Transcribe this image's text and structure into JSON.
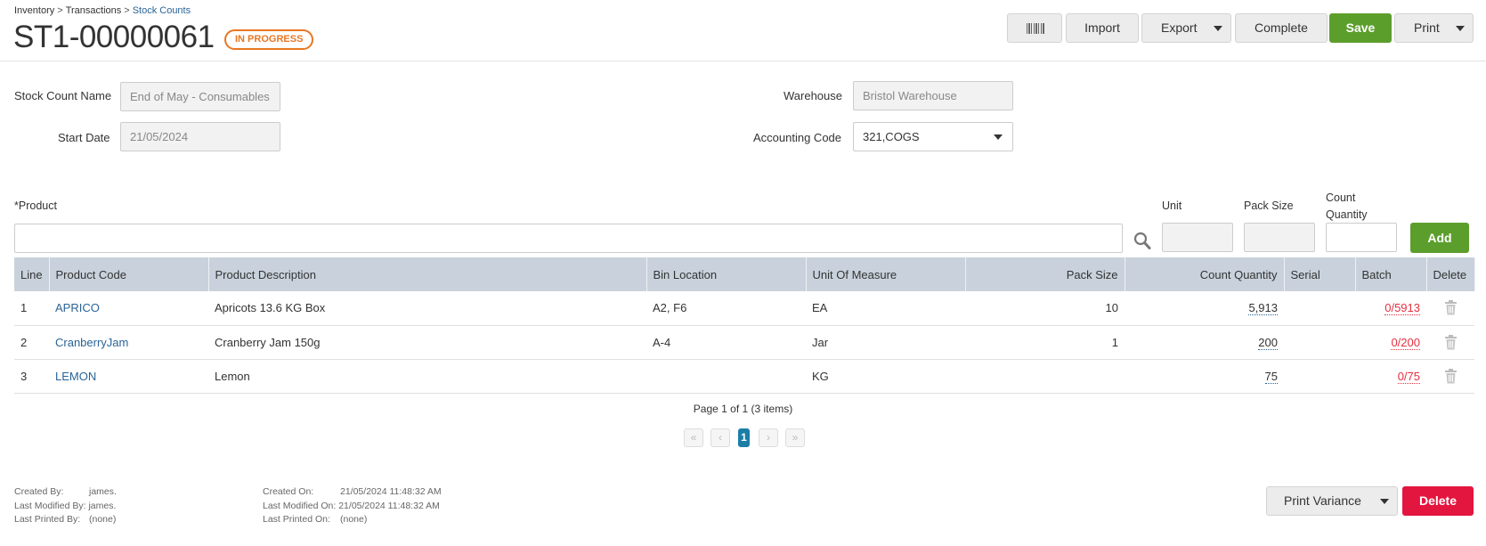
{
  "breadcrumb": {
    "items": [
      "Inventory",
      "Transactions",
      "Stock Counts"
    ],
    "separator": ">"
  },
  "title": "ST1-00000061",
  "status": {
    "label": "IN PROGRESS",
    "color": "#e87722"
  },
  "toolbar": {
    "barcode_icon": "barcode-icon",
    "import_label": "Import",
    "export_label": "Export",
    "complete_label": "Complete",
    "save_label": "Save",
    "print_label": "Print"
  },
  "form": {
    "stock_count_name": {
      "label": "Stock Count Name",
      "placeholder": "End of May - Consumables"
    },
    "start_date": {
      "label": "Start Date",
      "value": "21/05/2024"
    },
    "warehouse": {
      "label": "Warehouse",
      "placeholder": "Bristol Warehouse"
    },
    "accounting_code": {
      "label": "Accounting Code",
      "value": "321,COGS"
    }
  },
  "add_row": {
    "product_label": "*Product",
    "product_value": "",
    "unit_label": "Unit",
    "pack_size_label": "Pack Size",
    "count_quantity_label_1": "Count",
    "count_quantity_label_2": "Quantity",
    "add_label": "Add"
  },
  "grid": {
    "headers": [
      "Line",
      "Product Code",
      "Product Description",
      "Bin Location",
      "Unit Of Measure",
      "Pack Size",
      "Count Quantity",
      "Serial",
      "Batch",
      "Delete"
    ],
    "rows": [
      {
        "line": "1",
        "code": "APRICO",
        "description": "Apricots 13.6 KG Box",
        "bin": "A2, F6",
        "uom": "EA",
        "pack": "10",
        "qty": "5,913",
        "serial": "",
        "batch": "0/5913"
      },
      {
        "line": "2",
        "code": "CranberryJam",
        "description": "Cranberry Jam 150g",
        "bin": "A-4",
        "uom": "Jar",
        "pack": "1",
        "qty": "200",
        "serial": "",
        "batch": "0/200"
      },
      {
        "line": "3",
        "code": "LEMON",
        "description": "Lemon",
        "bin": "",
        "uom": "KG",
        "pack": "",
        "qty": "75",
        "serial": "",
        "batch": "0/75"
      }
    ]
  },
  "pagination": {
    "info": "Page 1 of 1 (3 items)",
    "first": "«",
    "prev": "‹",
    "current": "1",
    "next": "›",
    "last": "»"
  },
  "audit": {
    "created_by_label": "Created By:",
    "created_by": "james.",
    "modified_by_label": "Last Modified By:",
    "modified_by": "james.",
    "printed_by_label": "Last Printed By:",
    "printed_by": "(none)",
    "created_on_label": "Created On:",
    "created_on": "21/05/2024 11:48:32 AM",
    "modified_on_label": "Last Modified On:",
    "modified_on": "21/05/2024 11:48:32 AM",
    "printed_on_label": "Last Printed On:",
    "printed_on": "(none)"
  },
  "footer": {
    "print_variance_label": "Print Variance",
    "delete_label": "Delete"
  },
  "colors": {
    "save": "#5c9e2c",
    "delete": "#e3163f",
    "link": "#2a6496",
    "batch": "#e3303f",
    "header_bg": "#c9d2dc",
    "page_active": "#1c7ea6"
  }
}
